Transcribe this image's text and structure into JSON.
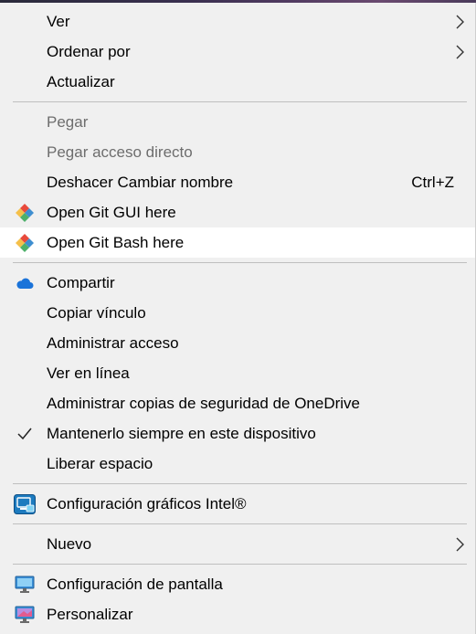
{
  "menu": {
    "items": {
      "ver": {
        "label": "Ver"
      },
      "ordenar": {
        "label": "Ordenar por"
      },
      "actualizar": {
        "label": "Actualizar"
      },
      "pegar": {
        "label": "Pegar"
      },
      "pegar_acceso": {
        "label": "Pegar acceso directo"
      },
      "deshacer": {
        "label": "Deshacer Cambiar nombre",
        "shortcut": "Ctrl+Z"
      },
      "git_gui": {
        "label": "Open Git GUI here",
        "icon": "git-icon"
      },
      "git_bash": {
        "label": "Open Git Bash here",
        "icon": "git-icon"
      },
      "compartir": {
        "label": "Compartir",
        "icon": "onedrive-cloud-icon"
      },
      "copiar_vinculo": {
        "label": "Copiar vínculo"
      },
      "admin_acceso": {
        "label": "Administrar acceso"
      },
      "ver_linea": {
        "label": "Ver en línea"
      },
      "admin_copias": {
        "label": "Administrar copias de seguridad de OneDrive"
      },
      "mantener": {
        "label": "Mantenerlo siempre en este dispositivo",
        "icon": "checkmark-icon"
      },
      "liberar": {
        "label": "Liberar espacio"
      },
      "intel": {
        "label": "Configuración gráficos Intel®",
        "icon": "intel-graphics-icon"
      },
      "nuevo": {
        "label": "Nuevo"
      },
      "pantalla": {
        "label": "Configuración de pantalla",
        "icon": "display-icon"
      },
      "personalizar": {
        "label": "Personalizar",
        "icon": "personalize-icon"
      }
    }
  },
  "colors": {
    "background": "#f0f0f0",
    "hover": "#ffffff",
    "disabled_text": "#6d6d6d",
    "separator": "#bfbfbf",
    "onedrive_blue": "#1a73d9"
  }
}
